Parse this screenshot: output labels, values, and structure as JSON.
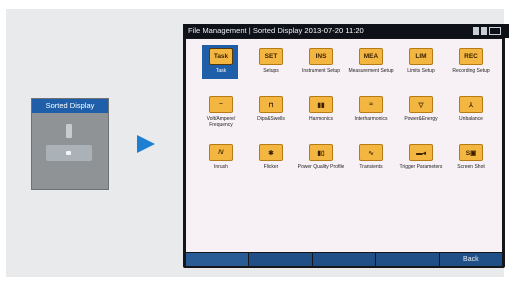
{
  "left": {
    "thumbnail_title": "Sorted Display"
  },
  "device": {
    "title": "File Management | Sorted Display",
    "datetime": "2013-07-20 11:20",
    "icons": [
      {
        "label": "Task",
        "glyph": "Task",
        "name": "task-icon"
      },
      {
        "label": "Setups",
        "glyph": "SET",
        "name": "setups-icon"
      },
      {
        "label": "Instrument Setup",
        "glyph": "INS",
        "name": "instrument-setup-icon"
      },
      {
        "label": "Measurement Setup",
        "glyph": "MEA",
        "name": "measurement-setup-icon"
      },
      {
        "label": "Limits Setup",
        "glyph": "LIM",
        "name": "limits-setup-icon"
      },
      {
        "label": "Recording Setup",
        "glyph": "REC",
        "name": "recording-setup-icon"
      },
      {
        "label": "Volt/Ampere/ Frequency",
        "glyph": "~",
        "name": "volt-ampere-frequency-icon"
      },
      {
        "label": "Dips&Swells",
        "glyph": "⊓",
        "name": "dips-swells-icon"
      },
      {
        "label": "Harmonics",
        "glyph": "▮▮",
        "name": "harmonics-icon"
      },
      {
        "label": "Interharmonics",
        "glyph": "≈",
        "name": "interharmonics-icon"
      },
      {
        "label": "Power&Energy",
        "glyph": "▽",
        "name": "power-energy-icon"
      },
      {
        "label": "Unbalance",
        "glyph": "⅄",
        "name": "unbalance-icon"
      },
      {
        "label": "Inrush",
        "glyph": "/\\/",
        "name": "inrush-icon"
      },
      {
        "label": "Flicker",
        "glyph": "✱",
        "name": "flicker-icon"
      },
      {
        "label": "Power Quality Profile",
        "glyph": "▮▯",
        "name": "power-quality-profile-icon"
      },
      {
        "label": "Transients",
        "glyph": "∿",
        "name": "transients-icon"
      },
      {
        "label": "Trigger Parameters",
        "glyph": "▬◂",
        "name": "trigger-parameters-icon"
      },
      {
        "label": "Screen Shot",
        "glyph": "S▣",
        "name": "screen-shot-icon"
      }
    ],
    "softkeys": [
      "",
      "",
      "",
      "",
      "Back"
    ]
  },
  "colors": {
    "accent": "#1f5fa9",
    "folder": "#f3b640",
    "arrow": "#1e7fd0"
  }
}
